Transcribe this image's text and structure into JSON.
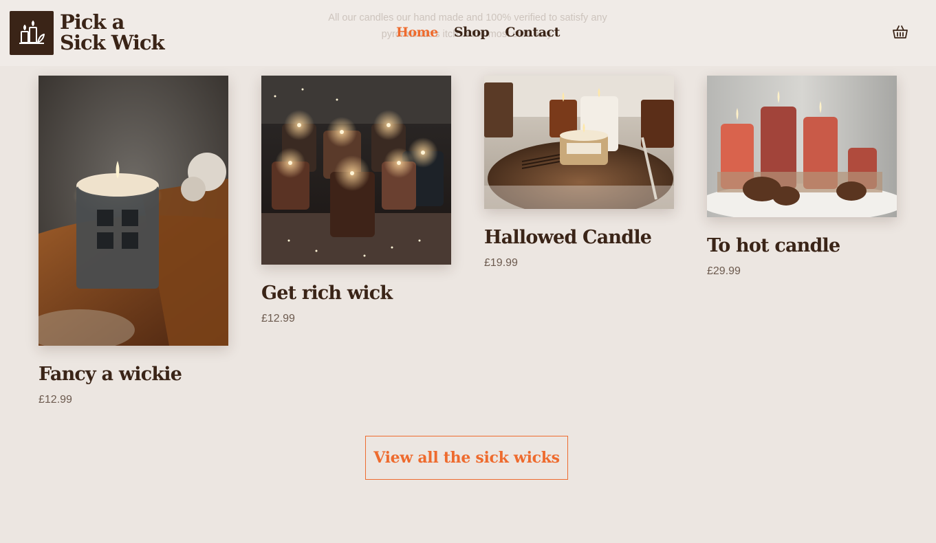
{
  "header": {
    "intro_text": "All our candles our hand made and 100% verified to satisfy any pyromaniac's itch in the most safe way.",
    "logo_line1": "Pick a",
    "logo_line2": "Sick Wick",
    "logo_icon": "candles-logo-icon",
    "nav": [
      {
        "label": "Home",
        "active": true
      },
      {
        "label": "Shop",
        "active": false
      },
      {
        "label": "Contact",
        "active": false
      }
    ],
    "cart_icon": "basket-icon"
  },
  "products": [
    {
      "name": "Fancy a wickie",
      "price": "£12.99",
      "image": "glass-jar-candle-on-wooden-tray-photo"
    },
    {
      "name": "Get rich wick",
      "price": "£12.99",
      "image": "candles-on-windowsill-with-fairy-lights-photo"
    },
    {
      "name": "Hallowed Candle",
      "price": "£19.99",
      "image": "candles-on-copper-tray-photo"
    },
    {
      "name": "To hot candle",
      "price": "£29.99",
      "image": "red-pillar-candles-with-pinecones-photo"
    }
  ],
  "view_all_label": "View all the sick wicks",
  "colors": {
    "accent": "#ee6b2e",
    "brand_dark": "#3a2417",
    "background": "#ece6e1"
  }
}
